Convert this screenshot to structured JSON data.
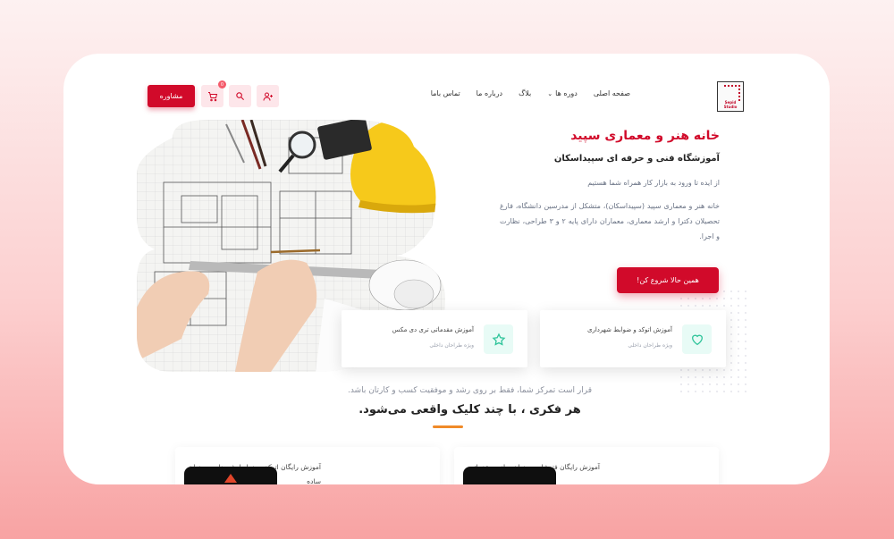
{
  "header": {
    "logo_text": "Sepid Studio",
    "nav": [
      {
        "label": "صفحه اصلی"
      },
      {
        "label": "دوره ها",
        "has_dropdown": true
      },
      {
        "label": "بلاگ"
      },
      {
        "label": "درباره ما"
      },
      {
        "label": "تماس باما"
      }
    ],
    "cart_count": "0",
    "consult_label": "مشاوره"
  },
  "hero": {
    "title": "خانه هنر و معماری سپید",
    "subtitle": "آموزشگاه فنی و حرفه ای سپیداسکان",
    "tagline": "از ایده تا ورود به بازار کار همراه شما هستیم",
    "description": "خانه هنر و معماری سپید (سپیداسکان)، متشکل از مدرسین دانشگاه، فارغ تحصیلان دکترا و ارشد معماری، معماران دارای پایه ۲ و ۳ طراحی، نظارت و اجرا.",
    "cta_label": "همین حالا شروع کن!"
  },
  "features": [
    {
      "title": "آموزش اتوکد و ضوابط شهرداری",
      "subtitle": "ویژه طراحان داخلی",
      "icon": "heart-icon"
    },
    {
      "title": "آموزش مقدماتی تری دی مکس",
      "subtitle": "ویژه طراحان داخلی",
      "icon": "star-icon"
    }
  ],
  "section": {
    "subtitle": "قرار است تمرکز شما، فقط بر روی رشد و موفقیت کسب و کارتان باشد.",
    "title": "هر فکری ، با چند کلیک واقعی می‌شود."
  },
  "courses": [
    {
      "title": "آموزش رایگان فتوشاپ به زبان ساده- مقدماتی"
    },
    {
      "title": "آموزش رایگان اتوکد و ضوابط شهرداری به زبان ساده"
    }
  ],
  "colors": {
    "brand": "#d10a2a",
    "accent": "#f08a28",
    "feature_icon": "#2fc49a"
  }
}
